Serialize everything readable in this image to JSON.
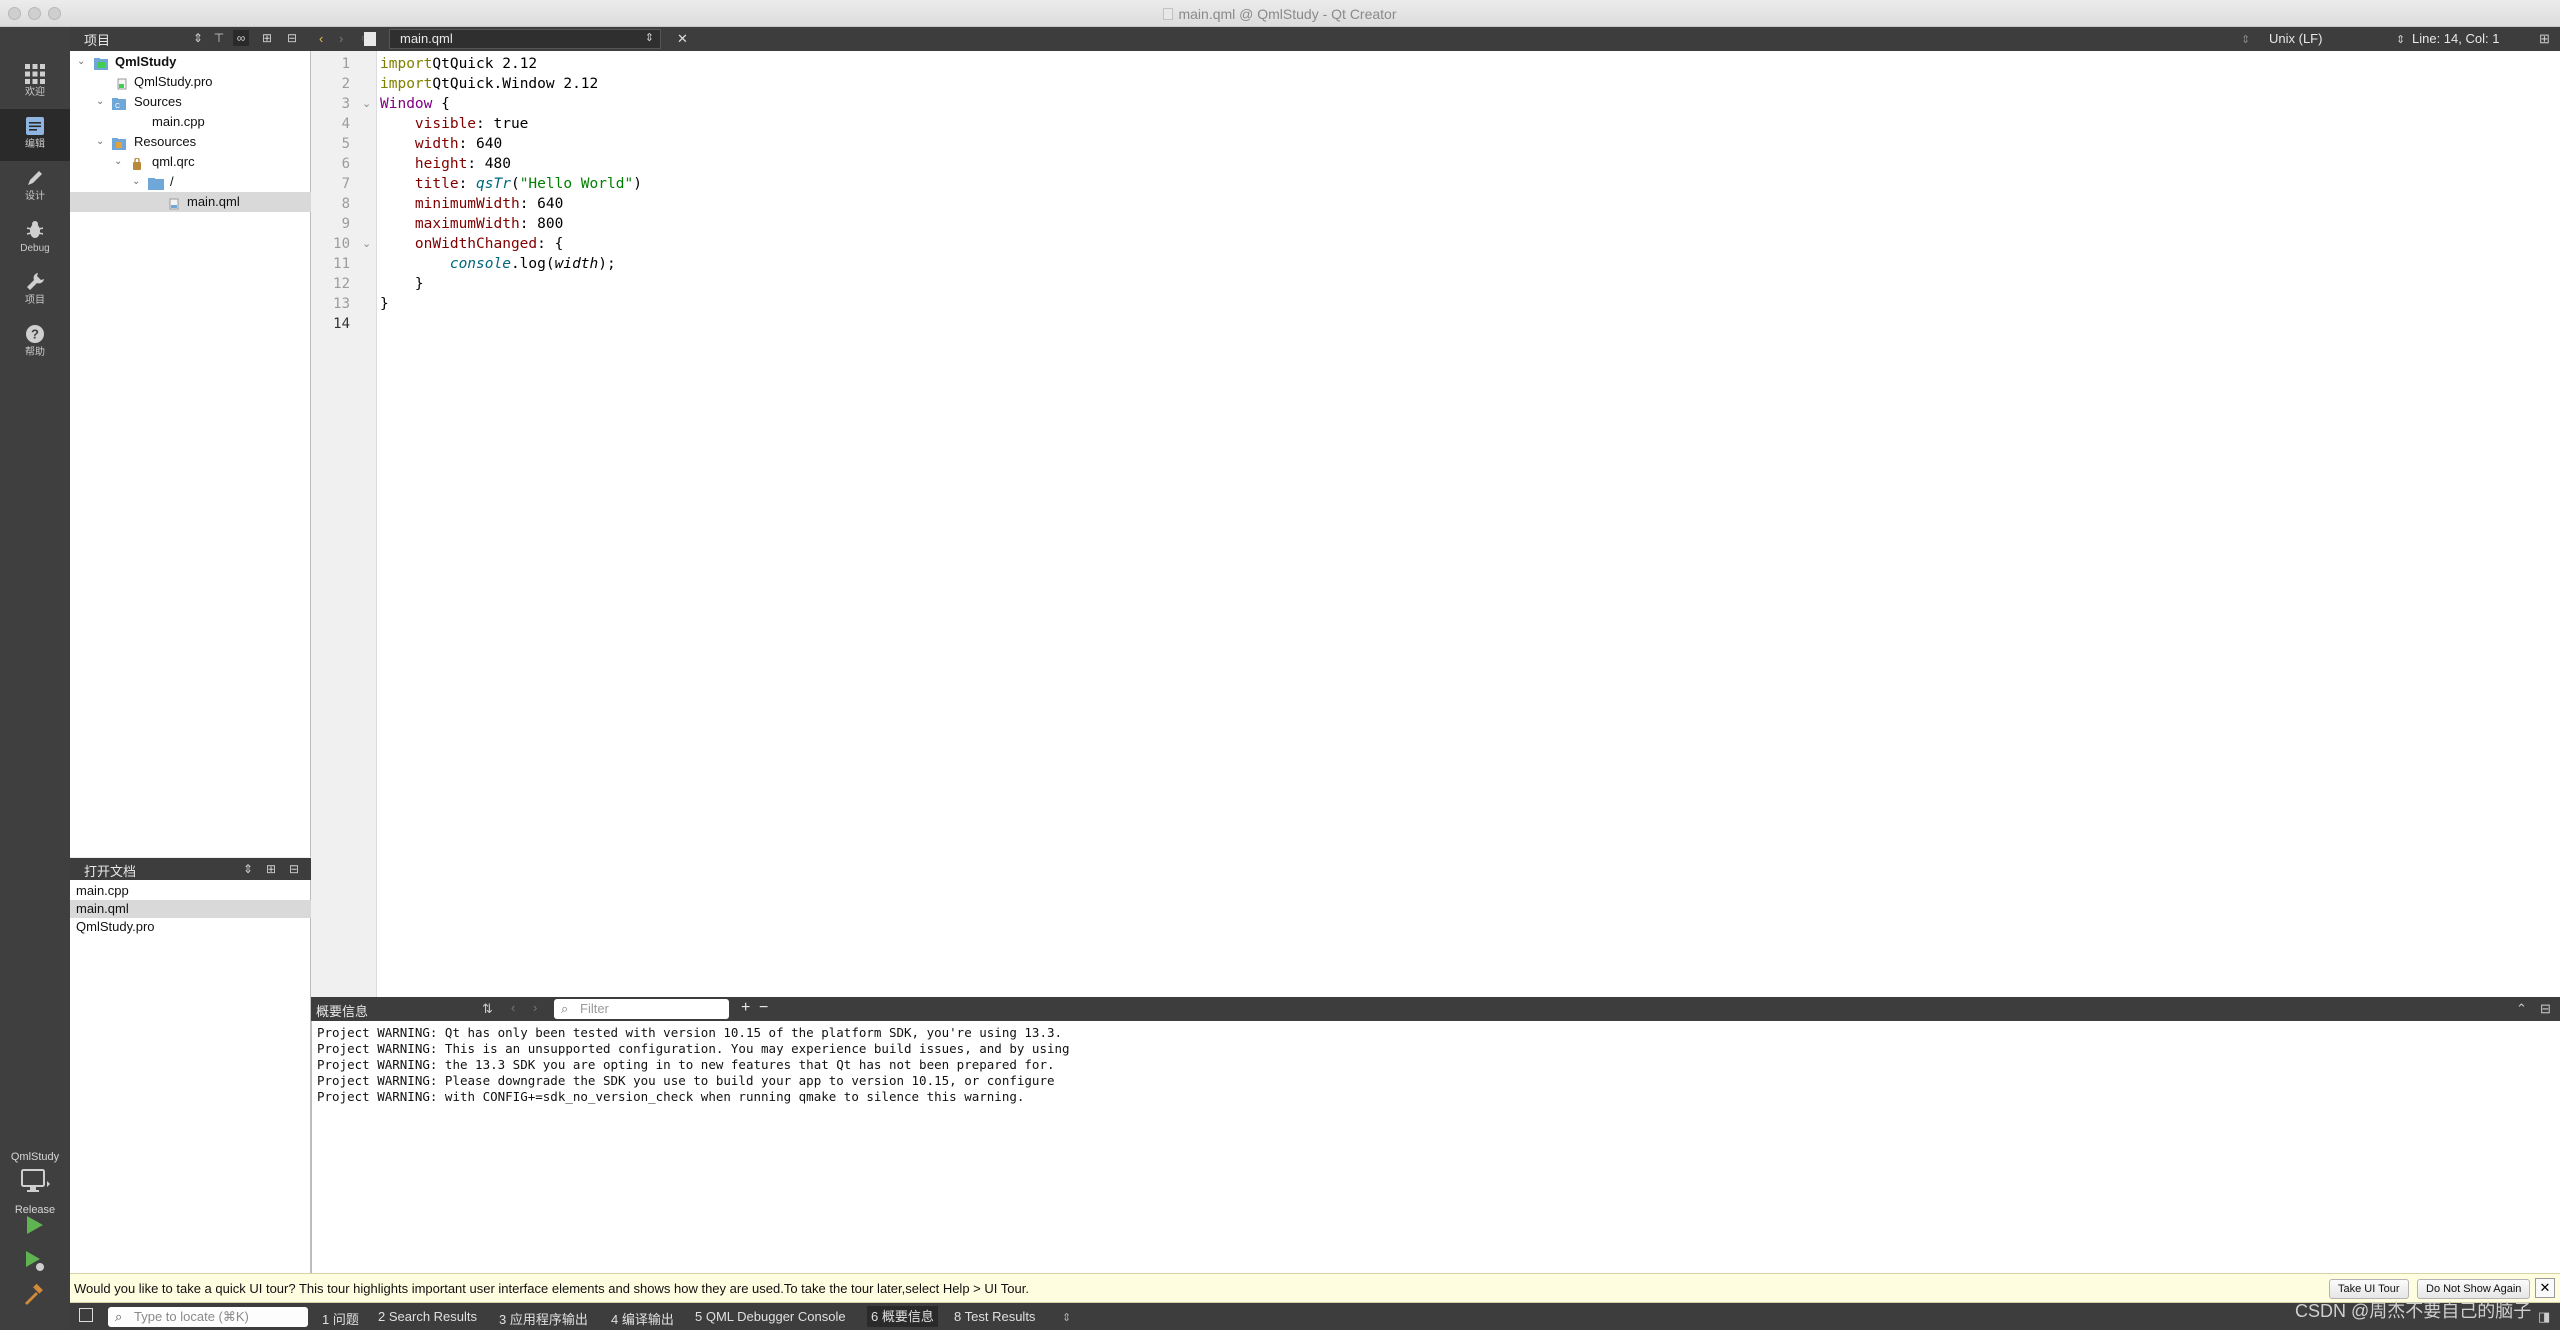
{
  "window": {
    "title": "main.qml @ QmlStudy - Qt Creator"
  },
  "modes": [
    {
      "label": "欢迎",
      "icon": "grid-icon"
    },
    {
      "label": "编辑",
      "icon": "edit-doc-icon"
    },
    {
      "label": "设计",
      "icon": "pencil-icon"
    },
    {
      "label": "Debug",
      "icon": "bug-icon"
    },
    {
      "label": "项目",
      "icon": "wrench-icon"
    },
    {
      "label": "帮助",
      "icon": "help-icon"
    }
  ],
  "kit": {
    "project": "QmlStudy",
    "build_config": "Release"
  },
  "project_panel": {
    "title": "项目",
    "tree": [
      {
        "label": "QmlStudy",
        "icon": "qt-project-icon",
        "expanded": true
      },
      {
        "label": "QmlStudy.pro",
        "icon": "pro-file-icon"
      },
      {
        "label": "Sources",
        "icon": "sources-folder-icon",
        "expanded": true
      },
      {
        "label": "main.cpp",
        "icon": "cpp-file-icon"
      },
      {
        "label": "Resources",
        "icon": "resources-folder-icon",
        "expanded": true
      },
      {
        "label": "qml.qrc",
        "icon": "qrc-file-icon",
        "expanded": true
      },
      {
        "label": "/",
        "icon": "folder-icon",
        "expanded": true
      },
      {
        "label": "main.qml",
        "icon": "qml-file-icon",
        "selected": true
      }
    ]
  },
  "open_documents": {
    "title": "打开文档",
    "items": [
      "main.cpp",
      "main.qml",
      "QmlStudy.pro"
    ],
    "selected": "main.qml"
  },
  "editor": {
    "file": "main.qml",
    "line_ending": "Unix (LF)",
    "cursor": "Line: 14, Col: 1",
    "current_line": 14,
    "line_numbers": [
      "1",
      "2",
      "3",
      "4",
      "5",
      "6",
      "7",
      "8",
      "9",
      "10",
      "11",
      "12",
      "13",
      "14"
    ],
    "code": [
      [
        [
          "kw",
          "import"
        ],
        [
          "",
          "QtQuick 2.12"
        ]
      ],
      [
        [
          "kw",
          "import"
        ],
        [
          "",
          "QtQuick.Window 2.12"
        ]
      ],
      [
        [
          "type",
          "Window"
        ],
        [
          "",
          " {"
        ]
      ],
      [
        [
          "",
          "    "
        ],
        [
          "prop",
          "visible"
        ],
        [
          "",
          ": true"
        ]
      ],
      [
        [
          "",
          "    "
        ],
        [
          "prop",
          "width"
        ],
        [
          "",
          ": 640"
        ]
      ],
      [
        [
          "",
          "    "
        ],
        [
          "prop",
          "height"
        ],
        [
          "",
          ": 480"
        ]
      ],
      [
        [
          "",
          "    "
        ],
        [
          "prop",
          "title"
        ],
        [
          "",
          ": "
        ],
        [
          "fn",
          "qsTr"
        ],
        [
          "",
          "("
        ],
        [
          "str",
          "\"Hello World\""
        ],
        [
          "",
          ")"
        ]
      ],
      [
        [
          "",
          "    "
        ],
        [
          "prop",
          "minimumWidth"
        ],
        [
          "",
          ": 640"
        ]
      ],
      [
        [
          "",
          "    "
        ],
        [
          "prop",
          "maximumWidth"
        ],
        [
          "",
          ": 800"
        ]
      ],
      [
        [
          "",
          "    "
        ],
        [
          "prop",
          "onWidthChanged"
        ],
        [
          "",
          ": {"
        ]
      ],
      [
        [
          "",
          "        "
        ],
        [
          "fn",
          "console"
        ],
        [
          "",
          ".log("
        ],
        [
          "it",
          "width"
        ],
        [
          "",
          ");"
        ]
      ],
      [
        [
          "",
          "    }"
        ]
      ],
      [
        [
          "",
          "}"
        ]
      ],
      [
        [
          "",
          ""
        ]
      ]
    ]
  },
  "output_pane": {
    "title": "概要信息",
    "filter_placeholder": "Filter",
    "lines": [
      "Project WARNING: Qt has only been tested with version 10.15 of the platform SDK, you're using 13.3.",
      "Project WARNING: This is an unsupported configuration. You may experience build issues, and by using",
      "Project WARNING: the 13.3 SDK you are opting in to new features that Qt has not been prepared for.",
      "Project WARNING: Please downgrade the SDK you use to build your app to version 10.15, or configure",
      "Project WARNING: with CONFIG+=sdk_no_version_check when running qmake to silence this warning."
    ]
  },
  "tour": {
    "message": "Would you like to take a quick UI tour? This tour highlights important user interface elements and shows how they are used.To take the tour later,select Help > UI Tour.",
    "take_label": "Take UI Tour",
    "dismiss_label": "Do Not Show Again"
  },
  "statusbar": {
    "locator_placeholder": "Type to locate (⌘K)",
    "tabs": [
      {
        "num": "1",
        "label": "问题"
      },
      {
        "num": "2",
        "label": "Search Results"
      },
      {
        "num": "3",
        "label": "应用程序输出"
      },
      {
        "num": "4",
        "label": "编译输出"
      },
      {
        "num": "5",
        "label": "QML Debugger Console"
      },
      {
        "num": "6",
        "label": "概要信息",
        "active": true
      },
      {
        "num": "8",
        "label": "Test Results"
      }
    ]
  },
  "watermark": "CSDN @周杰不要自己的脑子"
}
